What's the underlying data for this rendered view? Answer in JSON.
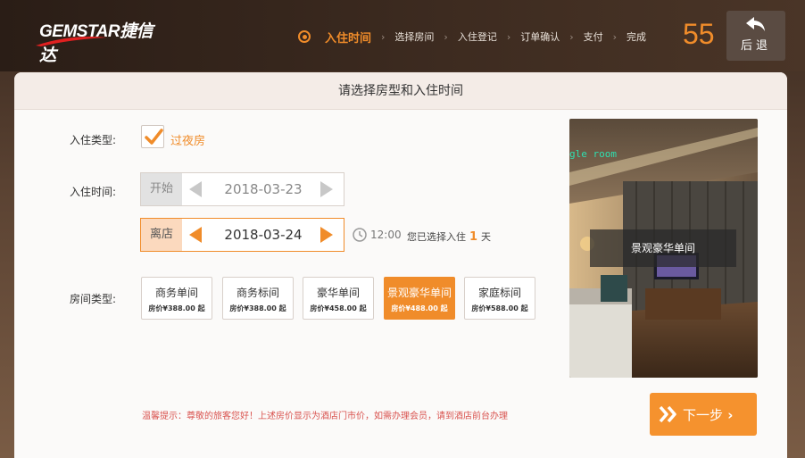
{
  "header": {
    "logo_text": "GEMSTAR捷信达",
    "steps": [
      "入住时间",
      "选择房间",
      "入住登记",
      "订单确认",
      "支付",
      "完成"
    ],
    "active_step": 0,
    "countdown": "55",
    "back_label": "后退"
  },
  "panel": {
    "title": "请选择房型和入住时间",
    "checkin_type_label": "入住类型:",
    "checkin_type_value": "过夜房",
    "checkin_type_checked": true,
    "checkin_time_label": "入住时间:",
    "start_tag": "开始",
    "start_date": "2018-03-23",
    "end_tag": "离店",
    "end_date": "2018-03-24",
    "checkout_time": "12:00",
    "nights_prefix": "您已选择入住",
    "nights": "1",
    "nights_suffix": "天",
    "room_type_label": "房间类型:",
    "rooms": [
      {
        "name": "商务单间",
        "price": "房价¥388.00 起"
      },
      {
        "name": "商务标间",
        "price": "房价¥388.00 起"
      },
      {
        "name": "豪华单间",
        "price": "房价¥458.00 起"
      },
      {
        "name": "景观豪华单间",
        "price": "房价¥488.00 起"
      },
      {
        "name": "家庭标间",
        "price": "房价¥588.00 起"
      }
    ],
    "selected_room": 3,
    "photo_caption": "景观豪华单间",
    "photo_overlay_text": "gle room",
    "notice": "温馨提示：尊敬的旅客您好！上述房价显示为酒店门市价，如需办理会员，请到酒店前台办理",
    "next_label": "下一步"
  },
  "colors": {
    "accent": "#f08c2a",
    "notice": "#d9534f"
  }
}
